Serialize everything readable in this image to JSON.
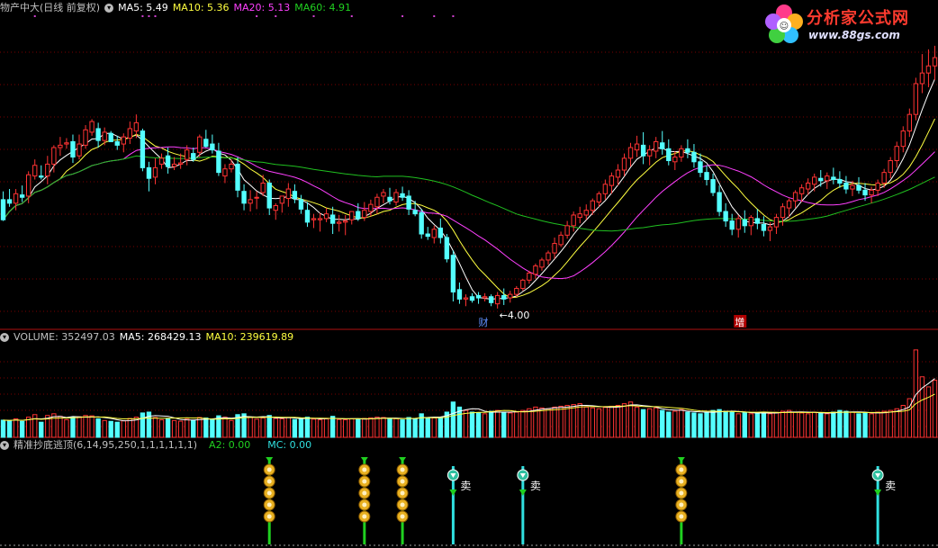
{
  "price_panel": {
    "stock_title": "物产中大(日线 前复权)",
    "ma5_label": "MA5: 5.49",
    "ma10_label": "MA10: 5.36",
    "ma20_label": "MA20: 5.13",
    "ma60_label": "MA60: 4.91",
    "low_marker": "4.00",
    "tag_cai": "财",
    "tag_zeng": "增"
  },
  "volume_panel": {
    "volume_label": "VOLUME: 352497.03",
    "ma5_label": "MA5: 268429.13",
    "ma10_label": "MA10: 239619.89"
  },
  "indicator_panel": {
    "title": "精准抄底逃顶(6,14,95,250,1,1,1,1,1,1)",
    "a2_label": "A2: 0.00",
    "mc_label": "MC: 0.00",
    "sell_label": "卖"
  },
  "logo": {
    "brand": "分析家公式网",
    "url": "www.88gs.com"
  },
  "colors": {
    "background": "#000000",
    "up_candle": "#ff3333",
    "down_candle": "#54ffff",
    "ma5": "#ffffff",
    "ma10": "#ffff40",
    "ma20": "#ff40ff",
    "ma60": "#20c020",
    "grid": "#7a0000",
    "buy_signal": "#20d020",
    "sell_signal": "#30e0e0",
    "coin": "#e8b020"
  },
  "chart_data": {
    "type": "candlestick",
    "bars": 148,
    "ylim": [
      3.8,
      6.4
    ],
    "low_annotation": 4.0,
    "ohlc": [
      [
        4.85,
        4.92,
        4.67,
        4.68
      ],
      [
        4.85,
        4.94,
        4.79,
        4.82
      ],
      [
        4.82,
        4.94,
        4.76,
        4.9
      ],
      [
        4.89,
        4.97,
        4.83,
        4.87
      ],
      [
        4.88,
        5.09,
        4.82,
        5.06
      ],
      [
        5.05,
        5.19,
        5.02,
        5.14
      ],
      [
        5.05,
        5.14,
        5.02,
        5.04
      ],
      [
        5.05,
        5.22,
        4.98,
        5.15
      ],
      [
        5.15,
        5.31,
        5.08,
        5.29
      ],
      [
        5.29,
        5.38,
        5.22,
        5.31
      ],
      [
        5.32,
        5.37,
        5.28,
        5.33
      ],
      [
        5.34,
        5.4,
        5.16,
        5.21
      ],
      [
        5.22,
        5.4,
        5.19,
        5.32
      ],
      [
        5.31,
        5.48,
        5.28,
        5.44
      ],
      [
        5.42,
        5.53,
        5.39,
        5.51
      ],
      [
        5.45,
        5.5,
        5.29,
        5.35
      ],
      [
        5.35,
        5.46,
        5.31,
        5.42
      ],
      [
        5.41,
        5.43,
        5.34,
        5.34
      ],
      [
        5.34,
        5.39,
        5.27,
        5.31
      ],
      [
        5.32,
        5.41,
        5.25,
        5.38
      ],
      [
        5.37,
        5.51,
        5.32,
        5.45
      ],
      [
        5.43,
        5.57,
        5.37,
        5.5
      ],
      [
        5.43,
        5.45,
        5.09,
        5.12
      ],
      [
        5.12,
        5.17,
        4.92,
        5.03
      ],
      [
        5.04,
        5.2,
        4.98,
        5.12
      ],
      [
        5.15,
        5.24,
        5.11,
        5.2
      ],
      [
        5.22,
        5.29,
        5.07,
        5.13
      ],
      [
        5.13,
        5.21,
        5.1,
        5.15
      ],
      [
        5.15,
        5.24,
        5.11,
        5.16
      ],
      [
        5.19,
        5.31,
        5.14,
        5.27
      ],
      [
        5.24,
        5.29,
        5.17,
        5.19
      ],
      [
        5.25,
        5.4,
        5.21,
        5.38
      ],
      [
        5.36,
        5.44,
        5.29,
        5.3
      ],
      [
        5.32,
        5.4,
        5.24,
        5.27
      ],
      [
        5.26,
        5.33,
        5.05,
        5.08
      ],
      [
        5.05,
        5.15,
        4.99,
        5.11
      ],
      [
        5.11,
        5.19,
        5.08,
        5.15
      ],
      [
        5.15,
        5.21,
        4.87,
        4.93
      ],
      [
        4.92,
        4.98,
        4.76,
        4.82
      ],
      [
        4.82,
        4.93,
        4.75,
        4.85
      ],
      [
        4.87,
        4.92,
        4.77,
        4.87
      ],
      [
        4.91,
        5.06,
        4.88,
        4.99
      ],
      [
        4.99,
        5.02,
        4.72,
        4.78
      ],
      [
        4.76,
        4.82,
        4.68,
        4.8
      ],
      [
        4.82,
        4.88,
        4.74,
        4.88
      ],
      [
        4.86,
        4.99,
        4.79,
        4.94
      ],
      [
        4.92,
        4.98,
        4.82,
        4.86
      ],
      [
        4.85,
        4.89,
        4.73,
        4.77
      ],
      [
        4.76,
        4.83,
        4.62,
        4.66
      ],
      [
        4.68,
        4.73,
        4.61,
        4.69
      ],
      [
        4.68,
        4.74,
        4.58,
        4.69
      ],
      [
        4.69,
        4.78,
        4.66,
        4.73
      ],
      [
        4.72,
        4.79,
        4.56,
        4.65
      ],
      [
        4.65,
        4.72,
        4.58,
        4.66
      ],
      [
        4.66,
        4.72,
        4.55,
        4.67
      ],
      [
        4.68,
        4.75,
        4.64,
        4.75
      ],
      [
        4.75,
        4.82,
        4.67,
        4.69
      ],
      [
        4.7,
        4.83,
        4.67,
        4.76
      ],
      [
        4.75,
        4.85,
        4.71,
        4.81
      ],
      [
        4.79,
        4.9,
        4.73,
        4.87
      ],
      [
        4.88,
        4.94,
        4.82,
        4.91
      ],
      [
        4.87,
        4.95,
        4.81,
        4.84
      ],
      [
        4.83,
        4.94,
        4.8,
        4.91
      ],
      [
        4.9,
        4.96,
        4.84,
        4.87
      ],
      [
        4.88,
        4.93,
        4.72,
        4.77
      ],
      [
        4.76,
        4.84,
        4.71,
        4.73
      ],
      [
        4.74,
        4.77,
        4.52,
        4.56
      ],
      [
        4.56,
        4.62,
        4.51,
        4.54
      ],
      [
        4.53,
        4.63,
        4.48,
        4.6
      ],
      [
        4.61,
        4.69,
        4.48,
        4.53
      ],
      [
        4.53,
        4.56,
        4.32,
        4.35
      ],
      [
        4.38,
        4.42,
        3.99,
        4.07
      ],
      [
        4.09,
        4.15,
        3.97,
        4.01
      ],
      [
        4.01,
        4.05,
        3.95,
        4.02
      ],
      [
        4.03,
        4.06,
        3.98,
        4.0
      ],
      [
        4.04,
        4.07,
        3.97,
        4.02
      ],
      [
        4.02,
        4.06,
        3.99,
        4.03
      ],
      [
        4.03,
        4.05,
        3.95,
        3.98
      ],
      [
        3.97,
        4.07,
        3.93,
        4.04
      ],
      [
        4.04,
        4.1,
        3.96,
        4.01
      ],
      [
        4.02,
        4.08,
        3.98,
        4.05
      ],
      [
        4.05,
        4.12,
        4.03,
        4.1
      ],
      [
        4.1,
        4.18,
        4.08,
        4.17
      ],
      [
        4.17,
        4.25,
        4.14,
        4.23
      ],
      [
        4.22,
        4.31,
        4.18,
        4.29
      ],
      [
        4.28,
        4.36,
        4.25,
        4.34
      ],
      [
        4.34,
        4.42,
        4.3,
        4.4
      ],
      [
        4.4,
        4.53,
        4.35,
        4.48
      ],
      [
        4.47,
        4.58,
        4.45,
        4.55
      ],
      [
        4.55,
        4.67,
        4.52,
        4.63
      ],
      [
        4.63,
        4.75,
        4.58,
        4.72
      ],
      [
        4.7,
        4.79,
        4.65,
        4.73
      ],
      [
        4.72,
        4.81,
        4.68,
        4.76
      ],
      [
        4.76,
        4.86,
        4.72,
        4.84
      ],
      [
        4.83,
        4.92,
        4.79,
        4.9
      ],
      [
        4.9,
        5.02,
        4.85,
        4.98
      ],
      [
        4.97,
        5.08,
        4.9,
        5.05
      ],
      [
        5.04,
        5.15,
        4.97,
        5.1
      ],
      [
        5.1,
        5.24,
        5.05,
        5.2
      ],
      [
        5.2,
        5.33,
        5.13,
        5.29
      ],
      [
        5.27,
        5.39,
        5.21,
        5.32
      ],
      [
        5.31,
        5.42,
        5.15,
        5.22
      ],
      [
        5.22,
        5.31,
        5.14,
        5.27
      ],
      [
        5.26,
        5.38,
        5.2,
        5.34
      ],
      [
        5.33,
        5.43,
        5.23,
        5.28
      ],
      [
        5.28,
        5.36,
        5.14,
        5.18
      ],
      [
        5.17,
        5.26,
        5.1,
        5.21
      ],
      [
        5.21,
        5.31,
        5.17,
        5.28
      ],
      [
        5.28,
        5.36,
        5.2,
        5.25
      ],
      [
        5.25,
        5.32,
        5.12,
        5.17
      ],
      [
        5.17,
        5.24,
        5.04,
        5.08
      ],
      [
        5.08,
        5.14,
        4.97,
        5.02
      ],
      [
        5.02,
        5.07,
        4.88,
        4.91
      ],
      [
        4.91,
        4.97,
        4.71,
        4.75
      ],
      [
        4.75,
        4.82,
        4.62,
        4.67
      ],
      [
        4.67,
        4.73,
        4.55,
        4.6
      ],
      [
        4.6,
        4.72,
        4.53,
        4.69
      ],
      [
        4.68,
        4.76,
        4.57,
        4.63
      ],
      [
        4.63,
        4.72,
        4.55,
        4.7
      ],
      [
        4.69,
        4.77,
        4.6,
        4.65
      ],
      [
        4.64,
        4.71,
        4.54,
        4.59
      ],
      [
        4.59,
        4.66,
        4.5,
        4.62
      ],
      [
        4.62,
        4.73,
        4.56,
        4.7
      ],
      [
        4.7,
        4.82,
        4.63,
        4.79
      ],
      [
        4.78,
        4.86,
        4.7,
        4.84
      ],
      [
        4.84,
        4.93,
        4.78,
        4.91
      ],
      [
        4.9,
        4.98,
        4.83,
        4.95
      ],
      [
        4.94,
        5.03,
        4.89,
        4.99
      ],
      [
        4.98,
        5.07,
        4.92,
        5.04
      ],
      [
        5.03,
        5.1,
        4.96,
        5.01
      ],
      [
        5.01,
        5.08,
        4.94,
        5.05
      ],
      [
        5.04,
        5.12,
        4.98,
        5.02
      ],
      [
        5.02,
        5.09,
        4.95,
        4.99
      ],
      [
        4.99,
        5.05,
        4.9,
        4.94
      ],
      [
        4.94,
        5.01,
        4.88,
        4.97
      ],
      [
        4.97,
        5.04,
        4.9,
        4.93
      ],
      [
        4.93,
        4.99,
        4.84,
        4.89
      ],
      [
        4.89,
        4.96,
        4.82,
        4.93
      ],
      [
        4.93,
        5.02,
        4.88,
        4.99
      ],
      [
        4.99,
        5.11,
        4.95,
        5.08
      ],
      [
        5.08,
        5.21,
        5.03,
        5.18
      ],
      [
        5.18,
        5.34,
        5.12,
        5.3
      ],
      [
        5.3,
        5.47,
        5.25,
        5.43
      ],
      [
        5.43,
        5.62,
        5.38,
        5.57
      ],
      [
        5.57,
        5.88,
        5.52,
        5.83
      ],
      [
        5.83,
        6.08,
        5.75,
        5.92
      ],
      [
        5.92,
        6.12,
        5.8,
        5.98
      ],
      [
        5.98,
        6.15,
        5.86,
        6.05
      ]
    ],
    "volume": [
      102,
      98,
      110,
      95,
      120,
      135,
      90,
      130,
      140,
      125,
      105,
      118,
      122,
      130,
      128,
      110,
      100,
      95,
      90,
      98,
      112,
      120,
      145,
      150,
      118,
      104,
      110,
      100,
      96,
      108,
      102,
      118,
      115,
      105,
      128,
      120,
      100,
      135,
      140,
      118,
      108,
      115,
      130,
      112,
      110,
      118,
      106,
      112,
      120,
      108,
      104,
      110,
      125,
      106,
      104,
      110,
      108,
      112,
      116,
      120,
      118,
      108,
      112,
      104,
      118,
      112,
      140,
      118,
      115,
      120,
      150,
      210,
      180,
      160,
      150,
      145,
      140,
      155,
      160,
      150,
      145,
      150,
      160,
      170,
      180,
      175,
      170,
      180,
      185,
      190,
      195,
      200,
      180,
      175,
      170,
      178,
      185,
      190,
      200,
      210,
      180,
      165,
      170,
      175,
      160,
      150,
      155,
      165,
      150,
      145,
      140,
      150,
      160,
      165,
      155,
      150,
      140,
      148,
      140,
      145,
      150,
      140,
      148,
      155,
      160,
      150,
      145,
      140,
      150,
      145,
      140,
      150,
      160,
      155,
      150,
      140,
      145,
      140,
      150,
      155,
      160,
      170,
      190,
      230,
      520,
      360,
      300,
      340
    ],
    "buy_signals": [
      42,
      57,
      63,
      107
    ],
    "sell_signals": [
      71,
      82,
      138
    ],
    "legend": [
      "MA5",
      "MA10",
      "MA20",
      "MA60"
    ]
  }
}
